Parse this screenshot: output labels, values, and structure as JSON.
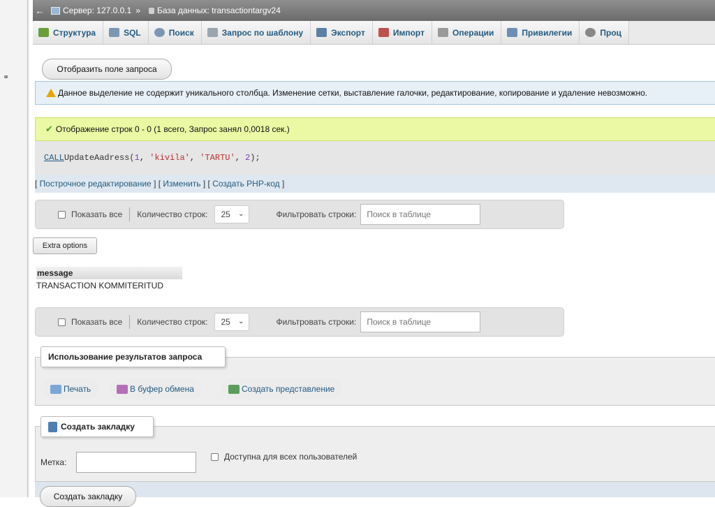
{
  "breadcrumb": {
    "back": "←",
    "server": "Сервер: 127.0.0.1",
    "separator": "»",
    "database": "База данных: transactiontargv24"
  },
  "tabs": [
    {
      "label": "Структура",
      "icon": "structure-icon",
      "color": "#6a9e3a"
    },
    {
      "label": "SQL",
      "icon": "sql-icon",
      "color": "#7c97b3"
    },
    {
      "label": "Поиск",
      "icon": "search-icon",
      "color": "#7c97b3"
    },
    {
      "label": "Запрос по шаблону",
      "icon": "query-template-icon",
      "color": "#9aa5b0"
    },
    {
      "label": "Экспорт",
      "icon": "export-icon",
      "color": "#5c7fa6"
    },
    {
      "label": "Импорт",
      "icon": "import-icon",
      "color": "#c0504d"
    },
    {
      "label": "Операции",
      "icon": "wrench-icon",
      "color": "#999999"
    },
    {
      "label": "Привилегии",
      "icon": "privileges-icon",
      "color": "#6d8fb5"
    },
    {
      "label": "Проц",
      "icon": "procedures-icon",
      "color": "#888888"
    }
  ],
  "show_query_button": "Отобразить поле запроса",
  "notice_text": "Данное выделение не содержит уникального столбца. Изменение сетки, выставление галочки, редактирование, копирование и удаление невозможно.",
  "success_text": "Отображение строк 0 - 0 (1 всего, Запрос занял 0,0018 сек.)",
  "sql": {
    "keyword": "CALL",
    "function": " UpdateAadress(",
    "arg1": "1",
    "comma1": ", ",
    "arg2": "'kivila'",
    "comma2": ", ",
    "arg3": "'TARTU'",
    "comma3": ", ",
    "arg4": "2",
    "end": ");"
  },
  "query_actions": {
    "open": "[",
    "inline_edit": " Построчное редактирование ",
    "mid1": "] [",
    "edit": " Изменить ",
    "mid2": "] [",
    "php": " Создать PHP-код ",
    "close": "]"
  },
  "nav": {
    "show_all": "Показать все",
    "rows_label": "Количество строк:",
    "rows_value": "25",
    "filter_label": "Фильтровать строки:",
    "filter_placeholder": "Поиск в таблице"
  },
  "extra_options": "Extra options",
  "results": {
    "column": "message",
    "rows": [
      "TRANSACTION KOMMITERITUD"
    ]
  },
  "query_results_ops": {
    "legend": "Использование результатов запроса",
    "print": "Печать",
    "clipboard": "В буфер обмена",
    "create_view": "Создать представление"
  },
  "bookmark": {
    "legend": "Создать закладку",
    "label": "Метка:",
    "public_label": "Доступна для всех пользователей",
    "submit": "Создать закладку"
  },
  "colors": {
    "link": "#235a81",
    "notice_bg": "#e8f0f7",
    "success_bg": "#ebf8a4"
  }
}
